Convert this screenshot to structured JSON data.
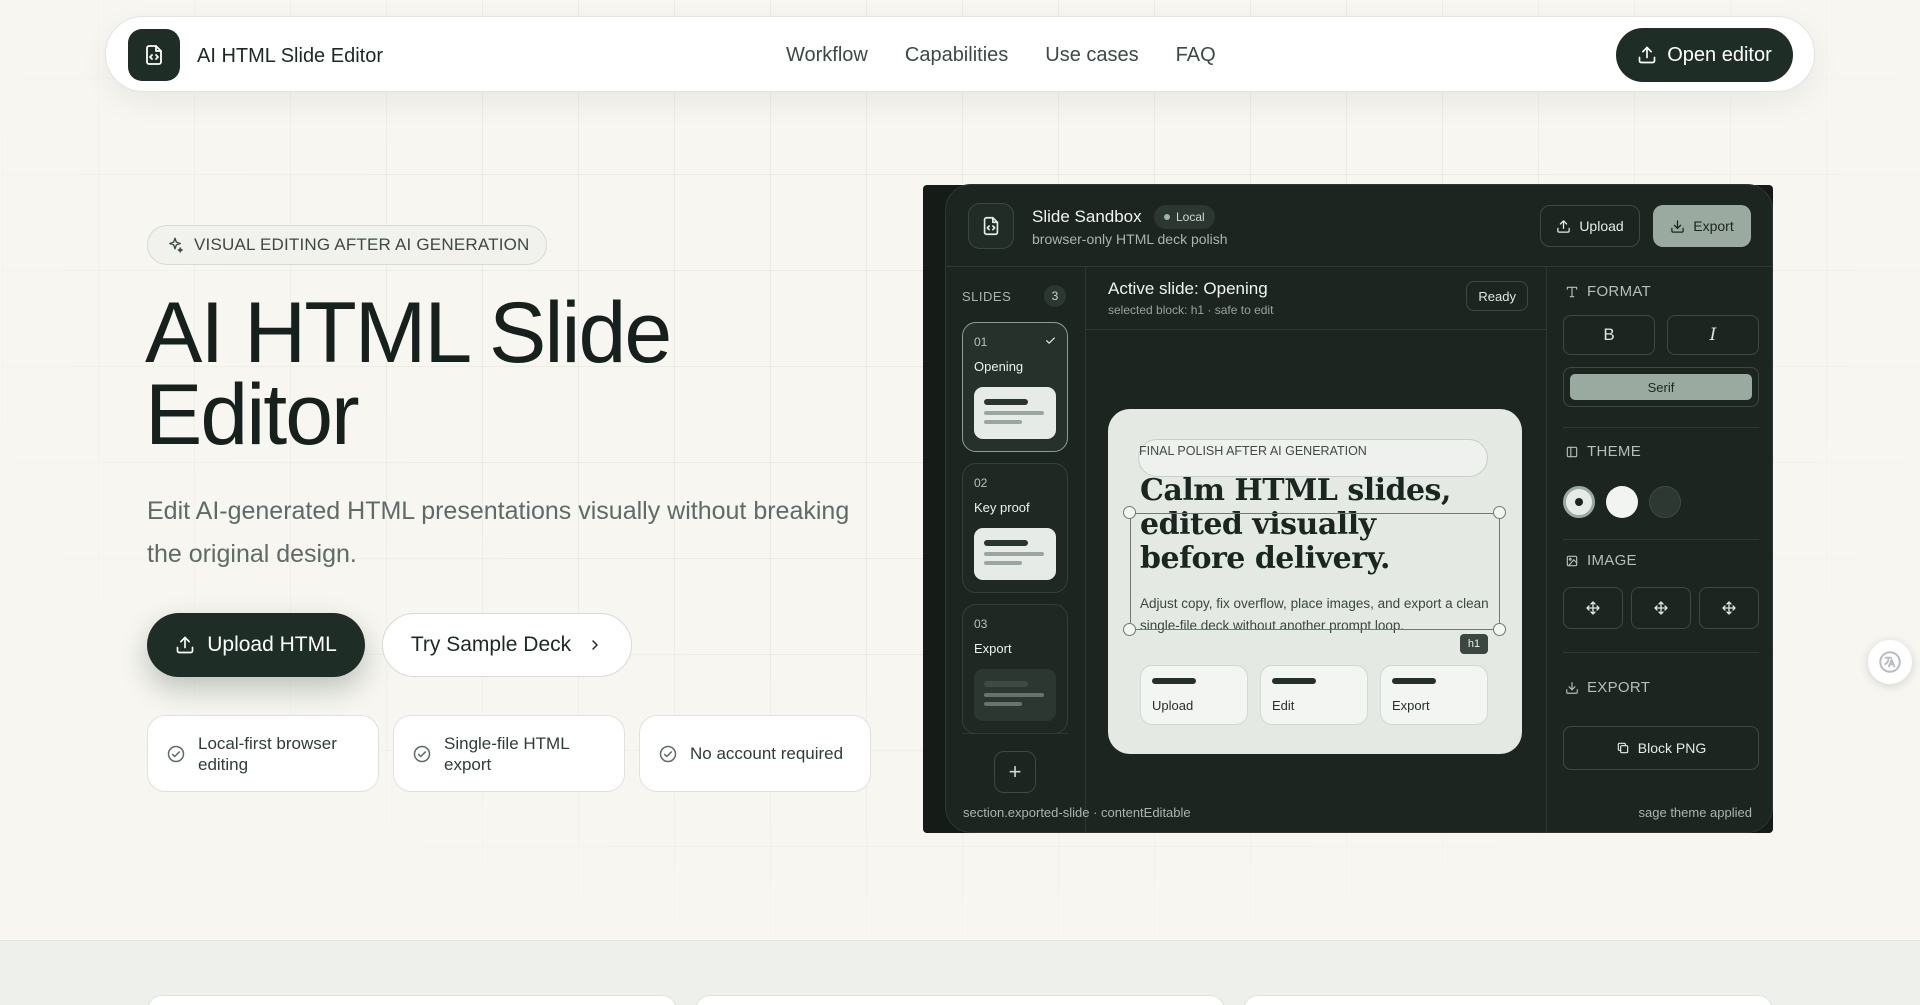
{
  "nav": {
    "brand": "AI HTML Slide Editor",
    "links": [
      "Workflow",
      "Capabilities",
      "Use cases",
      "FAQ"
    ],
    "open_editor": "Open editor"
  },
  "hero": {
    "pill": "VISUAL EDITING AFTER AI GENERATION",
    "title_line1": "AI HTML Slide",
    "title_line2": "Editor",
    "subtitle": "Edit AI-generated HTML presentations visually without breaking the original design.",
    "upload_button": "Upload HTML",
    "sample_button": "Try Sample Deck",
    "features": [
      "Local-first browser editing",
      "Single-file HTML export",
      "No account required"
    ]
  },
  "mockup": {
    "title": "Slide Sandbox",
    "badge": "Local",
    "subtitle": "browser-only HTML deck polish",
    "upload": "Upload",
    "export": "Export",
    "slides_label": "SLIDES",
    "slides_count": "3",
    "slides": [
      {
        "num": "01",
        "name": "Opening"
      },
      {
        "num": "02",
        "name": "Key proof"
      },
      {
        "num": "03",
        "name": "Export"
      }
    ],
    "add_label": "+",
    "active_title": "Active slide: Opening",
    "active_sub": "selected block: h1 · safe to edit",
    "ready": "Ready",
    "slide": {
      "eyebrow": "FINAL POLISH AFTER AI GENERATION",
      "headline": "Calm HTML slides, edited visually before delivery.",
      "body": "Adjust copy, fix overflow, place images, and export a clean single-file deck without another prompt loop.",
      "tag": "h1",
      "cards": [
        "Upload",
        "Edit",
        "Export"
      ]
    },
    "canvas_footer": "section.exported-slide · contentEditable",
    "format_label": "FORMAT",
    "bold": "B",
    "italic": "I",
    "font": "Serif",
    "theme_label": "THEME",
    "image_label": "IMAGE",
    "export_label": "EXPORT",
    "block_png": "Block PNG",
    "format_footer": "sage theme applied"
  },
  "colors": {
    "accent_dark": "#1f2d27",
    "sage": "#9aaaa1",
    "page_bg": "#f7f6f1"
  }
}
